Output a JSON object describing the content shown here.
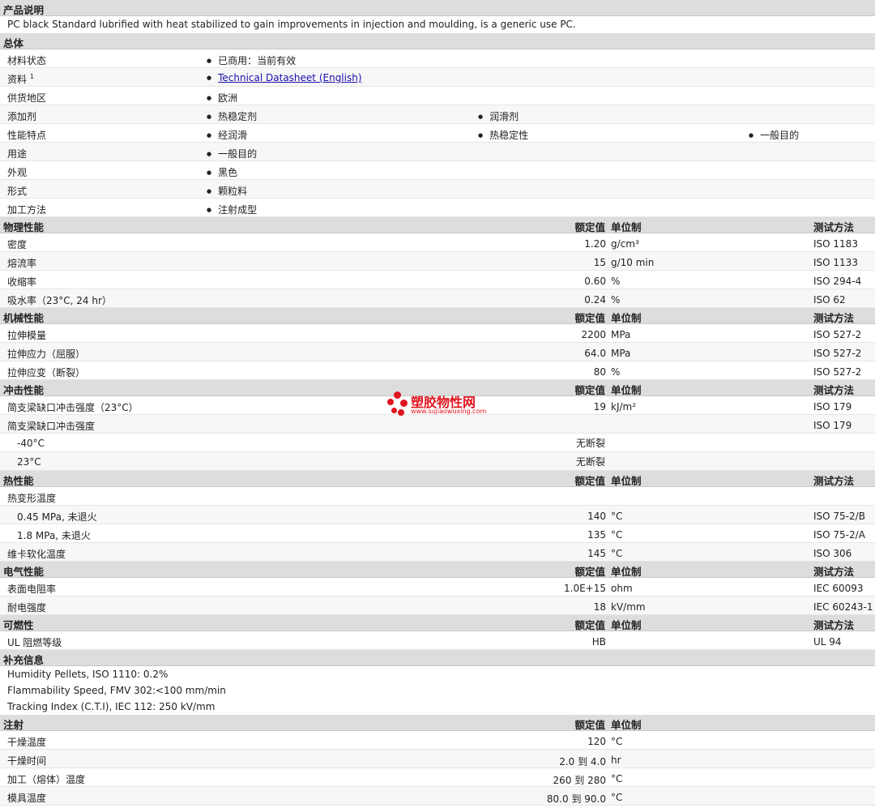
{
  "desc": {
    "title": "产品说明",
    "text": "PC black Standard lubrified with heat stabilized to gain improvements in injection and moulding, is a generic use PC."
  },
  "general": {
    "title": "总体",
    "material_status": {
      "label": "材料状态",
      "value": "已商用：当前有效"
    },
    "document": {
      "label": "资料",
      "sup": "1",
      "link": "Technical Datasheet (English)"
    },
    "region": {
      "label": "供货地区",
      "value": "欧洲"
    },
    "additive": {
      "label": "添加剂",
      "v1": "热稳定剂",
      "v2": "润滑剂"
    },
    "features": {
      "label": "性能特点",
      "v1": "经润滑",
      "v2": "热稳定性",
      "v3": "一般目的"
    },
    "uses": {
      "label": "用途",
      "value": "一般目的"
    },
    "appearance": {
      "label": "外观",
      "value": "黑色"
    },
    "form": {
      "label": "形式",
      "value": "颗粒料"
    },
    "processing": {
      "label": "加工方法",
      "value": "注射成型"
    }
  },
  "headers": {
    "nominal": "额定值",
    "unit": "单位制",
    "method": "测试方法"
  },
  "physical": {
    "title": "物理性能",
    "rows": [
      {
        "label": "密度",
        "value": "1.20",
        "unit": "g/cm³",
        "method": "ISO 1183"
      },
      {
        "label": "熔流率",
        "value": "15",
        "unit": "g/10 min",
        "method": "ISO 1133"
      },
      {
        "label": "收缩率",
        "value": "0.60",
        "unit": "%",
        "method": "ISO 294-4"
      },
      {
        "label": "吸水率（23°C, 24 hr）",
        "value": "0.24",
        "unit": "%",
        "method": "ISO 62"
      }
    ]
  },
  "mechanical": {
    "title": "机械性能",
    "rows": [
      {
        "label": "拉伸模量",
        "value": "2200",
        "unit": "MPa",
        "method": "ISO 527-2"
      },
      {
        "label": "拉伸应力（屈服）",
        "value": "64.0",
        "unit": "MPa",
        "method": "ISO 527-2"
      },
      {
        "label": "拉伸应变（断裂）",
        "value": "80",
        "unit": "%",
        "method": "ISO 527-2"
      }
    ]
  },
  "impact": {
    "title": "冲击性能",
    "r1": {
      "label": "简支梁缺口冲击强度（23°C）",
      "value": "19",
      "unit": "kJ/m²",
      "method": "ISO 179"
    },
    "r2": {
      "label": "简支梁缺口冲击强度",
      "method": "ISO 179"
    },
    "r3": {
      "label": "-40°C",
      "value": "无断裂"
    },
    "r4": {
      "label": "23°C",
      "value": "无断裂"
    }
  },
  "thermal": {
    "title": "热性能",
    "r1": {
      "label": "热变形温度"
    },
    "r2": {
      "label": "0.45 MPa, 未退火",
      "value": "140",
      "unit": "°C",
      "method": "ISO 75-2/B"
    },
    "r3": {
      "label": "1.8 MPa, 未退火",
      "value": "135",
      "unit": "°C",
      "method": "ISO 75-2/A"
    },
    "r4": {
      "label": "维卡软化温度",
      "value": "145",
      "unit": "°C",
      "method": "ISO 306"
    }
  },
  "electrical": {
    "title": "电气性能",
    "rows": [
      {
        "label": "表面电阻率",
        "value": "1.0E+15",
        "unit": "ohm",
        "method": "IEC 60093"
      },
      {
        "label": "耐电强度",
        "value": "18",
        "unit": "kV/mm",
        "method": "IEC 60243-1"
      }
    ]
  },
  "flammability": {
    "title": "可燃性",
    "r1": {
      "label": "UL 阻燃等级",
      "value": "HB",
      "method": "UL 94"
    }
  },
  "supplement": {
    "title": "补充信息",
    "lines": [
      "Humidity Pellets, ISO 1110: 0.2%",
      "Flammability Speed, FMV 302:<100 mm/min",
      "Tracking Index (C.T.I), IEC 112: 250 kV/mm"
    ]
  },
  "injection": {
    "title": "注射",
    "rows": [
      {
        "label": "干燥温度",
        "value": "120",
        "unit": "°C"
      },
      {
        "label": "干燥时间",
        "value": "2.0 到  4.0",
        "unit": "hr"
      },
      {
        "label": "加工（熔体）温度",
        "value": "260 到  280",
        "unit": "°C"
      },
      {
        "label": "模具温度",
        "value": "80.0 到  90.0",
        "unit": "°C"
      }
    ]
  },
  "watermark": {
    "cn": "塑胶物性网",
    "url": "www.sujiaowuxing.com",
    "color": "#e0141e"
  }
}
